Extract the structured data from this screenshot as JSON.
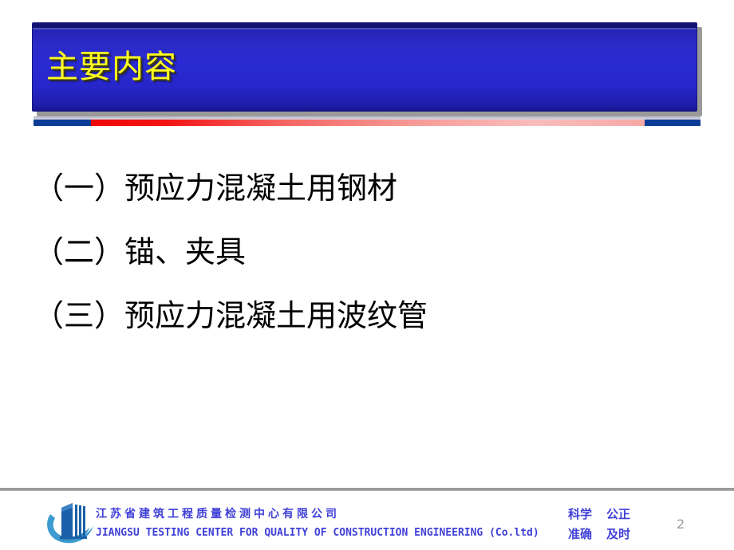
{
  "slide": {
    "number": "2",
    "title": "主要内容",
    "title_color": "#ffff22",
    "banner_color": "#2a2ad2",
    "accent_red": "#ee0000",
    "accent_blue": "#0b3c96"
  },
  "content": {
    "items": [
      {
        "label": "（一）预应力混凝土用钢材"
      },
      {
        "label": "（二）锚、夹具"
      },
      {
        "label": "（三）预应力混凝土用波纹管"
      }
    ]
  },
  "footer": {
    "logo_icon": "building-swoosh-logo-icon",
    "company_cn": "江苏省建筑工程质量检测中心有限公司",
    "company_en": "JIANGSU TESTING CENTER FOR QUALITY OF CONSTRUCTION ENGINEERING (Co.ltd)",
    "text_color": "#4040d8",
    "slogan": {
      "row1_left": "科学",
      "row1_right": "公正",
      "row2_left": "准确",
      "row2_right": "及时"
    }
  }
}
